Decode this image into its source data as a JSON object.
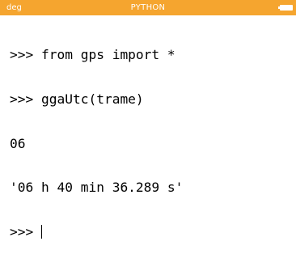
{
  "status_bar": {
    "angle_mode": "deg",
    "app_name": "PYTHON",
    "battery_icon": "battery-icon",
    "background_color": "#f5a52f",
    "text_color": "#ffffff"
  },
  "console": {
    "lines": [
      ">>> from gps import *",
      ">>> ggaUtc(trame)",
      "06",
      "'06 h 40 min 36.289 s'"
    ],
    "prompt": ">>> "
  }
}
